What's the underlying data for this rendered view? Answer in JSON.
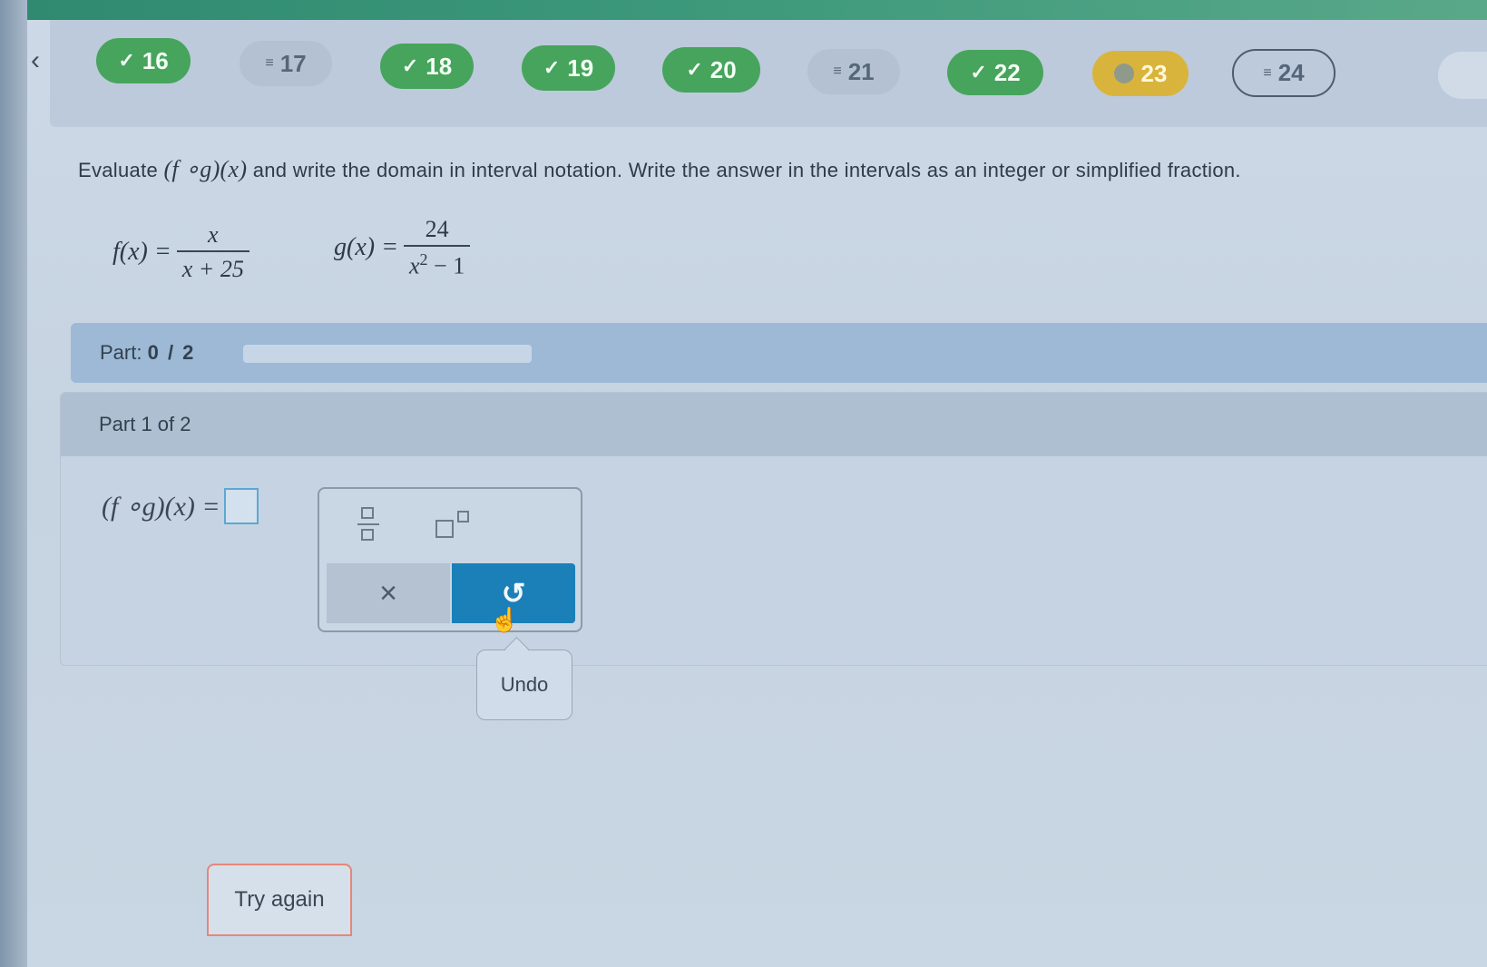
{
  "nav": {
    "back_icon": "chevron-left-icon",
    "questions": [
      {
        "number": "16",
        "status": "done"
      },
      {
        "number": "17",
        "status": "open"
      },
      {
        "number": "18",
        "status": "done"
      },
      {
        "number": "19",
        "status": "done"
      },
      {
        "number": "20",
        "status": "done"
      },
      {
        "number": "21",
        "status": "open"
      },
      {
        "number": "22",
        "status": "done"
      },
      {
        "number": "23",
        "status": "partial"
      },
      {
        "number": "24",
        "status": "current"
      }
    ]
  },
  "question": {
    "prefix": "Evaluate",
    "expr": "(f ∘g)(x)",
    "text": "and write the domain in interval notation. Write the answer in the intervals as an integer or simplified fraction."
  },
  "functions": {
    "f": {
      "lhs": "f(x) =",
      "num": "x",
      "den": "x + 25"
    },
    "g": {
      "lhs": "g(x) =",
      "num": "24",
      "den_base": "x",
      "den_exp": "2",
      "den_rest": " − 1"
    }
  },
  "part_bar": {
    "label": "Part:",
    "progress": "0 / 2",
    "fraction_complete": 0
  },
  "part_card": {
    "title": "Part 1 of 2",
    "answer_label": "(f ∘g)(x) ="
  },
  "keypad": {
    "fraction_icon": "fraction-icon",
    "exponent_icon": "exponent-icon",
    "clear_symbol": "×",
    "undo_symbol": "↺"
  },
  "tooltip": {
    "text": "Undo"
  },
  "try_again": {
    "label": "Try again"
  },
  "colors": {
    "done": "#46a45c",
    "partial": "#d9b43c",
    "accent": "#1b7fb8"
  }
}
